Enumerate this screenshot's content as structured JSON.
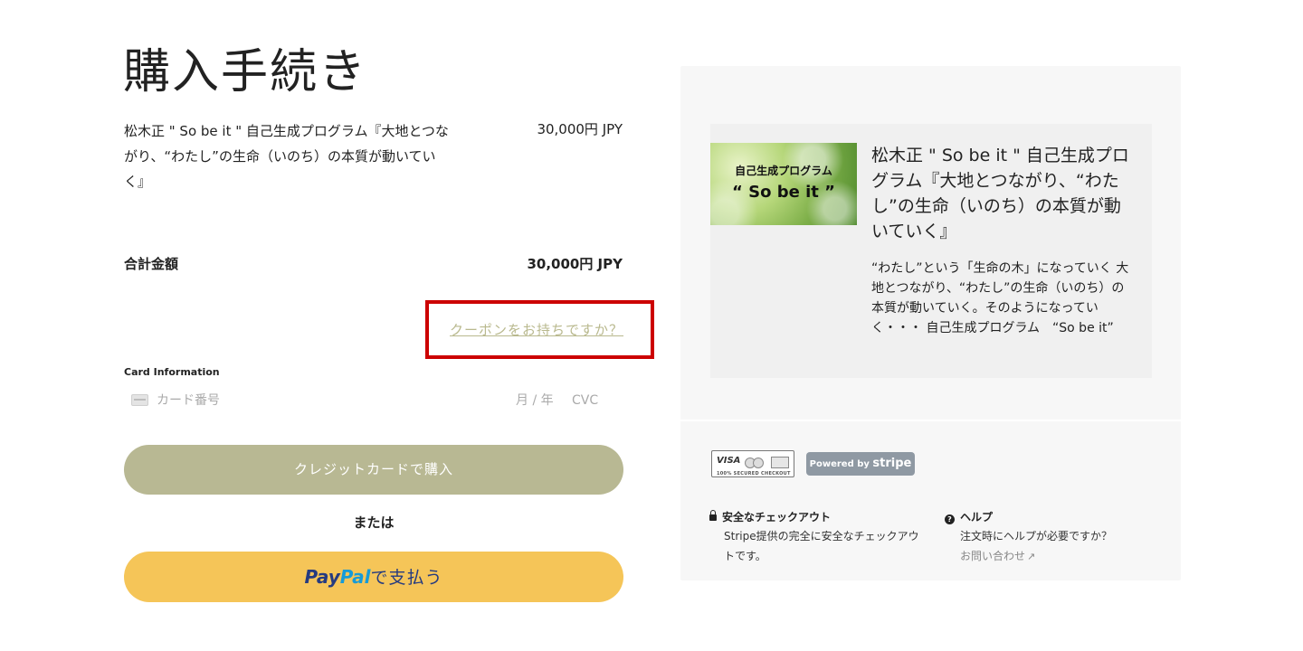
{
  "page": {
    "title": "購入手続き"
  },
  "order": {
    "product_name": "松木正 \" So be it \" 自己生成プログラム『大地とつながり、“わたし”の生命（いのち）の本質が動いていく』",
    "product_price": "30,000円 JPY",
    "total_label": "合計金額",
    "total_value": "30,000円 JPY"
  },
  "coupon": {
    "link_label": "クーポンをお持ちですか？"
  },
  "card": {
    "section_label": "Card Information",
    "number_placeholder": "カード番号",
    "expiry_placeholder": "月 / 年",
    "cvc_placeholder": "CVC"
  },
  "actions": {
    "card_button_label": "クレジットカードで購入",
    "or_label": "または",
    "paypal_pay": "Pay",
    "paypal_pal": "Pal",
    "paypal_suffix": "で支払う"
  },
  "summary": {
    "image_line1": "自己生成プログラム",
    "image_line2": "“ So be it ”",
    "card_title": "松木正 \" So be it \" 自己生成プログラム『大地とつながり、“わたし”の生命（いのち）の本質が動いていく』",
    "card_description": "“わたし”という「生命の木」になっていく 大地とつながり、“わたし”の生命（いのち）の本質が動いていく。そのようになっていく・・・ 自己生成プログラム　“So be it”"
  },
  "badges": {
    "visa": "VISA",
    "secured": "100% SECURED CHECKOUT",
    "powered_by": "Powered by",
    "stripe": "stripe"
  },
  "footer": {
    "secure_title": "安全なチェックアウト",
    "secure_text": "Stripe提供の完全に安全なチェックアウトです。",
    "help_title": "ヘルプ",
    "help_text": "注文時にヘルプが必要ですか？",
    "contact_link": "お問い合わせ"
  }
}
